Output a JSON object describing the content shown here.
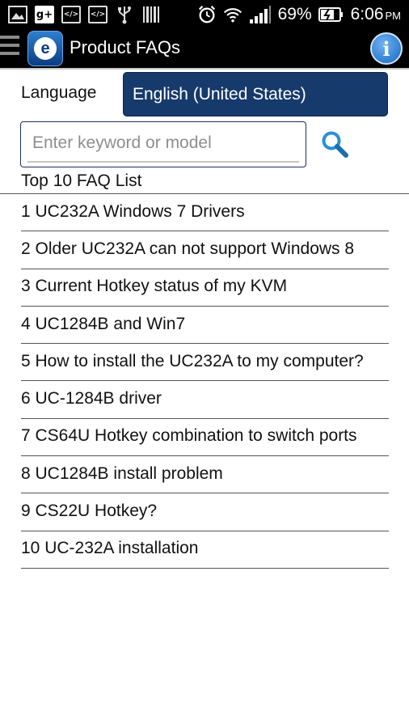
{
  "status_bar": {
    "battery_percent": "69%",
    "time": "6:06",
    "ampm": "PM",
    "icons": [
      "gallery-icon",
      "google-plus-icon",
      "code-icon",
      "code-icon",
      "usb-icon",
      "barcode-icon",
      "alarm-icon",
      "wifi-icon",
      "signal-icon",
      "battery-charging-icon"
    ],
    "gplus_label": "g+",
    "code_label": "</>"
  },
  "header": {
    "title": "Product FAQs",
    "logo_glyph": "e",
    "info_glyph": "i"
  },
  "language": {
    "label": "Language",
    "selected": "English (United States)"
  },
  "search": {
    "placeholder": "Enter keyword or model",
    "value": ""
  },
  "faq": {
    "title": "Top 10 FAQ List",
    "items": [
      "1 UC232A Windows 7 Drivers",
      "2 Older UC232A can not support Windows 8",
      "3 Current Hotkey status of my KVM",
      "4 UC1284B and Win7",
      "5 How to install the UC232A to my computer?",
      "6 UC-1284B driver",
      "7 CS64U Hotkey combination to switch ports",
      "8 UC1284B install problem",
      "9 CS22U Hotkey?",
      "10 UC-232A installation"
    ]
  },
  "colors": {
    "accent_navy": "#163a6b",
    "info_blue": "#1666c4",
    "search_icon_blue": "#2a8fd6"
  }
}
